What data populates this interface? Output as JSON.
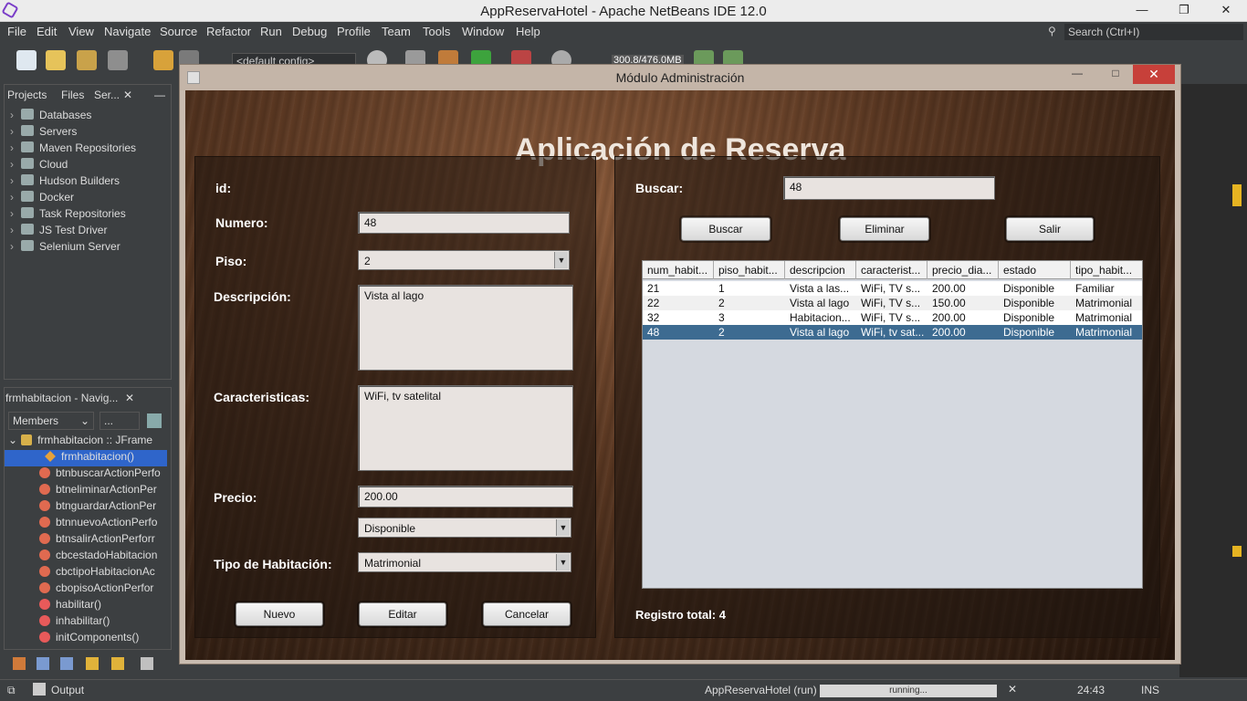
{
  "ide": {
    "title": "AppReservaHotel - Apache NetBeans IDE 12.0",
    "menu": [
      "File",
      "Edit",
      "View",
      "Navigate",
      "Source",
      "Refactor",
      "Run",
      "Debug",
      "Profile",
      "Team",
      "Tools",
      "Window",
      "Help"
    ],
    "search_placeholder": "Search (Ctrl+I)",
    "config": "<default config>",
    "memory": "300.8/476.0MB",
    "status": {
      "output_tab": "Output",
      "run_label": "AppReservaHotel (run)",
      "progress_text": "running...",
      "position": "24:43",
      "mode": "INS"
    }
  },
  "projects_panel": {
    "tabs": [
      "Projects",
      "Files",
      "Ser..."
    ],
    "items": [
      "Databases",
      "Servers",
      "Maven Repositories",
      "Cloud",
      "Hudson Builders",
      "Docker",
      "Task Repositories",
      "JS Test Driver",
      "Selenium Server"
    ]
  },
  "navigator": {
    "title": "frmhabitacion - Navig...",
    "filter": "Members",
    "filter2": "...",
    "root": "frmhabitacion :: JFrame",
    "members": [
      "frmhabitacion()",
      "btnbuscarActionPerfo",
      "btneliminarActionPer",
      "btnguardarActionPer",
      "btnnuevoActionPerfo",
      "btnsalirActionPerforr",
      "cbcestadoHabitacion",
      "cbctipoHabitacionAc",
      "cbopisoActionPerfor",
      "habilitar()",
      "inhabilitar()",
      "initComponents()"
    ]
  },
  "app": {
    "window_title": "Módulo Administración",
    "heading": "Aplicación de  Reserva",
    "form": {
      "id_label": "id:",
      "numero_label": "Numero:",
      "numero_value": "48",
      "piso_label": "Piso:",
      "piso_value": "2",
      "descripcion_label": "Descripción:",
      "descripcion_value": "Vista al lago",
      "caracteristicas_label": "Caracteristicas:",
      "caracteristicas_value": "WiFi, tv satelital",
      "precio_label": "Precio:",
      "precio_value": "200.00",
      "estado_value": "Disponible",
      "tipo_label": "Tipo de Habitación:",
      "tipo_value": "Matrimonial",
      "nuevo_btn": "Nuevo",
      "editar_btn": "Editar",
      "cancelar_btn": "Cancelar"
    },
    "search": {
      "label": "Buscar:",
      "value": "48",
      "buscar_btn": "Buscar",
      "eliminar_btn": "Eliminar",
      "salir_btn": "Salir"
    },
    "table": {
      "columns": [
        "num_habit...",
        "piso_habit...",
        "descripcion",
        "caracterist...",
        "precio_dia...",
        "estado",
        "tipo_habit..."
      ],
      "rows": [
        [
          "21",
          "1",
          "Vista a las...",
          "WiFi, TV s...",
          "200.00",
          "Disponible",
          "Familiar"
        ],
        [
          "22",
          "2",
          "Vista al lago",
          "WiFi, TV s...",
          "150.00",
          "Disponible",
          "Matrimonial"
        ],
        [
          "32",
          "3",
          "Habitacion...",
          "WiFi, TV s...",
          "200.00",
          "Disponible",
          "Matrimonial"
        ],
        [
          "48",
          "2",
          "Vista al lago",
          "WiFi, tv sat...",
          "200.00",
          "Disponible",
          "Matrimonial"
        ]
      ],
      "selected_row": 3
    },
    "total_label": "Registro total: 4"
  }
}
